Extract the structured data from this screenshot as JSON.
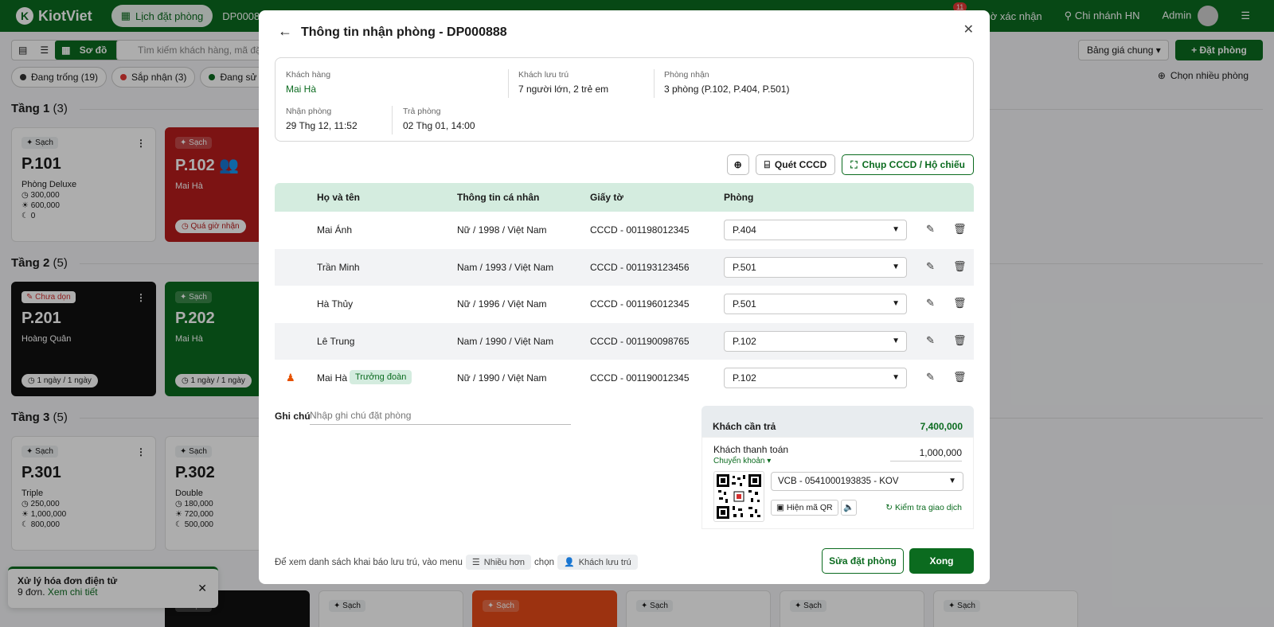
{
  "topbar": {
    "logo": "KiotViet",
    "tab": "Lịch đặt phòng",
    "booking_code": "DP000890",
    "notif_count": "11",
    "pending_label": "ờ xác nhận",
    "branch": "Chi nhánh HN",
    "user": "Admin"
  },
  "toolbar": {
    "view_grid": "Sơ đồ",
    "search_placeholder": "Tìm kiếm khách hàng, mã đặt",
    "price_list": "Bảng giá chung",
    "book_btn": "Đặt phòng"
  },
  "filters": [
    {
      "label": "Đang trống (19)",
      "color": "#333333"
    },
    {
      "label": "Sắp nhận (3)",
      "color": "#e53935"
    },
    {
      "label": "Đang sử dụ",
      "color": "#0b6b1f"
    }
  ],
  "multi_select": "Chọn nhiều phòng",
  "floors": [
    {
      "name": "Tầng 1",
      "count": "(3)"
    },
    {
      "name": "Tầng 2",
      "count": "(5)"
    },
    {
      "name": "Tầng 3",
      "count": "(5)"
    }
  ],
  "rooms": {
    "p101": {
      "tag": "Sạch",
      "name": "P.101",
      "type": "Phòng Deluxe",
      "p1": "300,000",
      "p2": "600,000",
      "p3": "0"
    },
    "p102": {
      "tag": "Sạch",
      "name": "P.102",
      "guest": "Mai Hà",
      "pill": "Quá giờ nhận"
    },
    "p201": {
      "tag": "Chưa dọn",
      "name": "P.201",
      "guest": "Hoàng Quân",
      "pill": "1 ngày / 1 ngày"
    },
    "p202": {
      "tag": "Sạch",
      "name": "P.202",
      "guest": "Mai Hà",
      "pill": "1 ngày / 1 ngày"
    },
    "p301": {
      "tag": "Sạch",
      "name": "P.301",
      "type": "Triple",
      "p1": "250,000",
      "p2": "1,000,000",
      "p3": "800,000"
    },
    "p302": {
      "tag": "Sạch",
      "name": "P.302",
      "type": "Double",
      "p1": "180,000",
      "p2": "720,000",
      "p3": "500,000"
    }
  },
  "bottom_tag": "Sạch",
  "toast": {
    "title": "Xử lý hóa đơn điện tử",
    "count": "9 đơn.",
    "link": "Xem chi tiết"
  },
  "modal": {
    "title": "Thông tin nhận phòng - DP000888",
    "summary": {
      "customer_label": "Khách hàng",
      "customer": "Mai Hà",
      "guests_label": "Khách lưu trú",
      "guests": "7 người lớn, 2 trẻ em",
      "rooms_label": "Phòng nhận",
      "rooms": "3 phòng (P.102, P.404, P.501)",
      "checkin_label": "Nhận phòng",
      "checkin": "29 Thg 12, 11:52",
      "checkout_label": "Trả phòng",
      "checkout": "02 Thg 01, 14:00"
    },
    "actions": {
      "scan": "Quét CCCD",
      "capture": "Chụp CCCD / Hộ chiếu"
    },
    "table": {
      "headers": {
        "name": "Họ và tên",
        "info": "Thông tin cá nhân",
        "doc": "Giấy tờ",
        "room": "Phòng"
      },
      "rows": [
        {
          "name": "Mai Ánh",
          "info": "Nữ / 1998 / Việt Nam",
          "doc": "CCCD - 001198012345",
          "room": "P.404"
        },
        {
          "name": "Trần Minh",
          "info": "Nam / 1993 / Việt Nam",
          "doc": "CCCD - 001193123456",
          "room": "P.501"
        },
        {
          "name": "Hà Thủy",
          "info": "Nữ / 1996 / Việt Nam",
          "doc": "CCCD - 001196012345",
          "room": "P.501"
        },
        {
          "name": "Lê Trung",
          "info": "Nam / 1990 / Việt Nam",
          "doc": "CCCD - 001190098765",
          "room": "P.102"
        },
        {
          "name": "Mai Hà",
          "badge": "Trưởng đoàn",
          "info": "Nữ / 1990 / Việt Nam",
          "doc": "CCCD - 001190012345",
          "room": "P.102"
        }
      ]
    },
    "note": {
      "label": "Ghi chú",
      "placeholder": "Nhập ghi chú đặt phòng"
    },
    "payment": {
      "due_label": "Khách cần trả",
      "due": "7,400,000",
      "paid_label": "Khách thanh toán",
      "method": "Chuyển khoản",
      "paid": "1,000,000",
      "bank": "VCB - 0541000193835 - KOV",
      "show_qr": "Hiện mã QR",
      "check": "Kiểm tra giao dịch"
    },
    "footer": {
      "hint_prefix": "Để xem danh sách khai báo lưu trú, vào menu",
      "menu_more": "Nhiều hơn",
      "hint_choose": "chọn",
      "menu_guests": "Khách lưu trú",
      "edit_btn": "Sửa đặt phòng",
      "done_btn": "Xong"
    }
  }
}
